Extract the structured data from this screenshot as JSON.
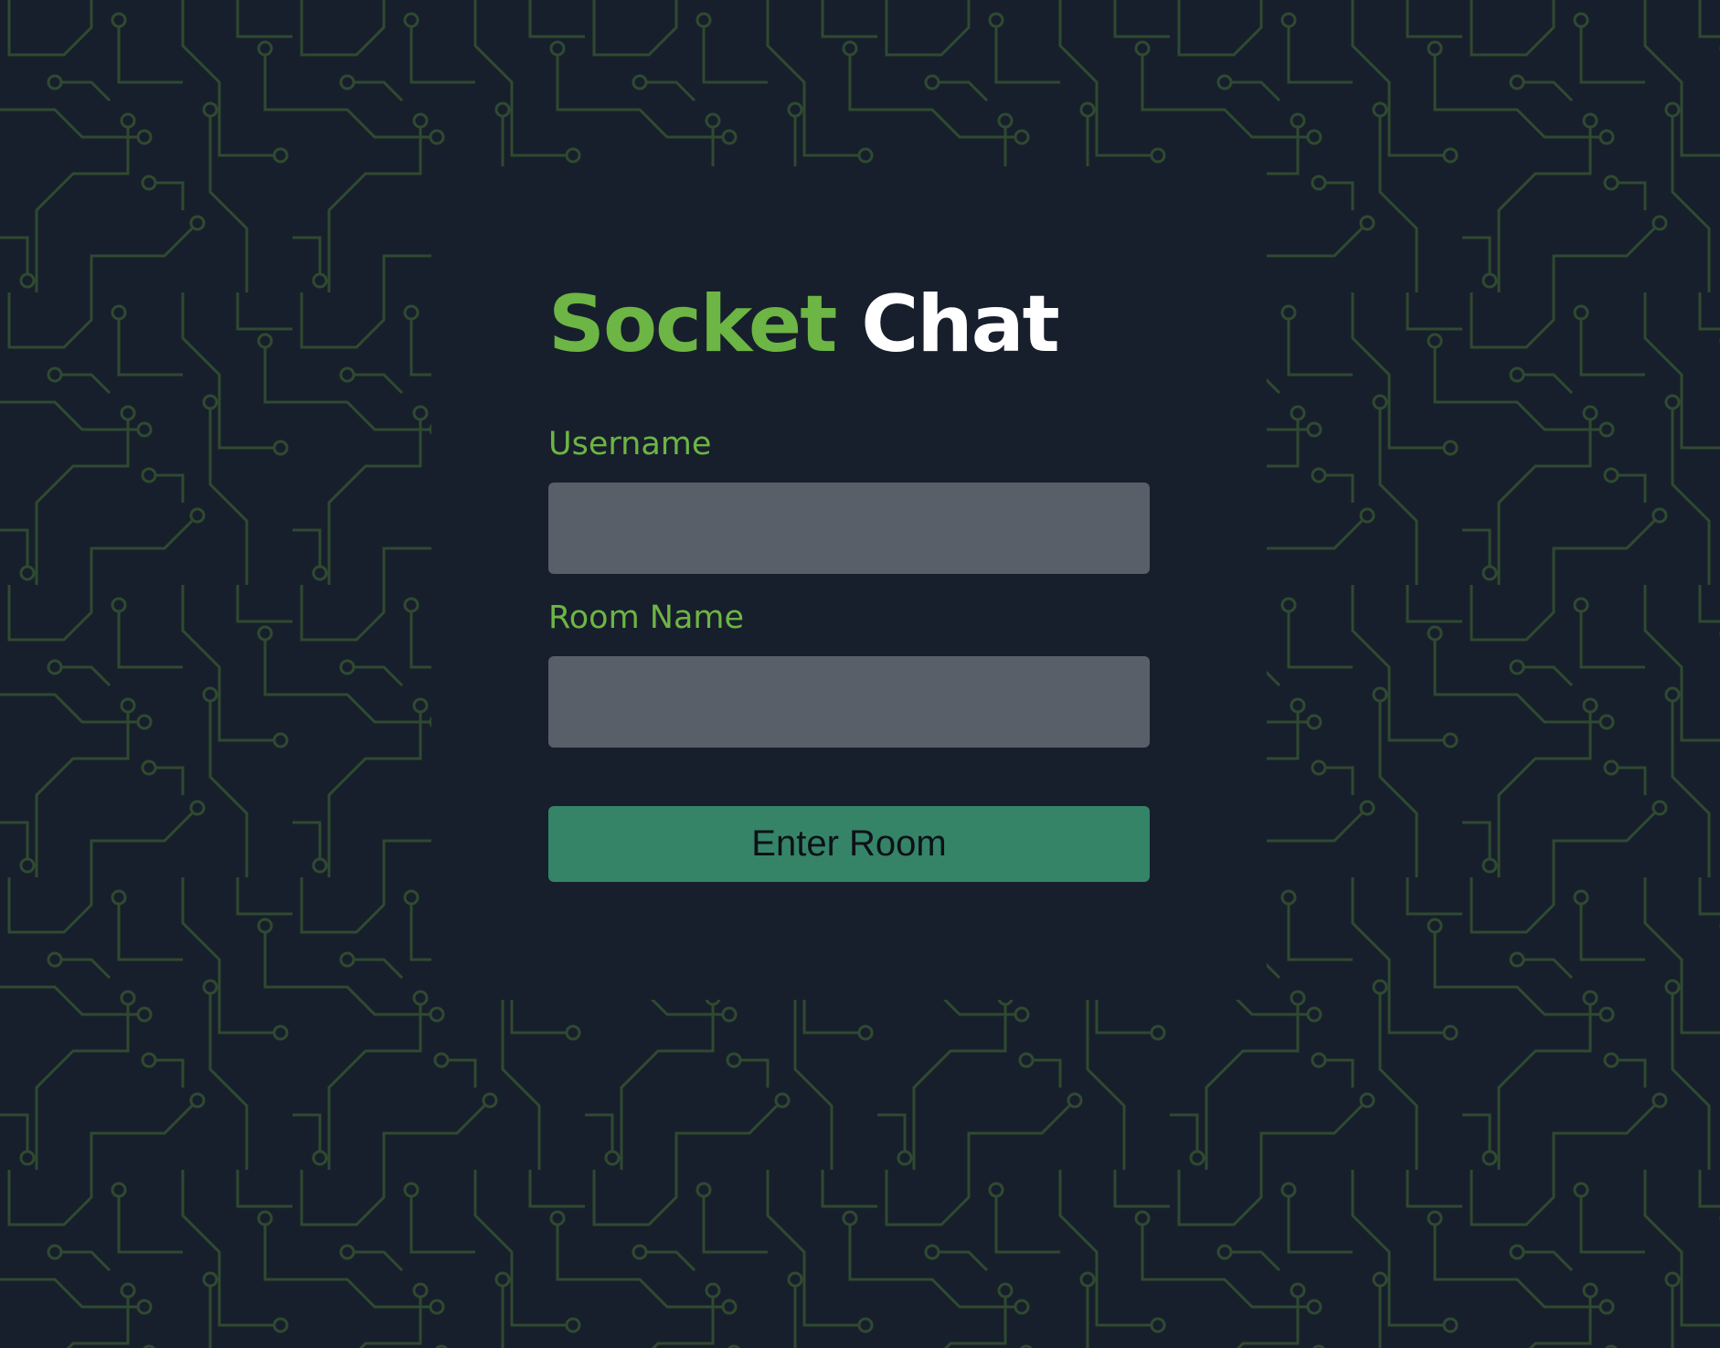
{
  "app": {
    "title_accent": "Socket",
    "title_main": "Chat"
  },
  "form": {
    "username_label": "Username",
    "username_value": "",
    "room_label": "Room Name",
    "room_value": "",
    "submit_label": "Enter Room"
  },
  "colors": {
    "background": "#171f2c",
    "circuit_trace": "#2f4a30",
    "accent": "#6db544",
    "input_bg": "#585f69",
    "button_bg": "#358468"
  },
  "icons": {
    "background_pattern": "circuit-board-pattern"
  }
}
